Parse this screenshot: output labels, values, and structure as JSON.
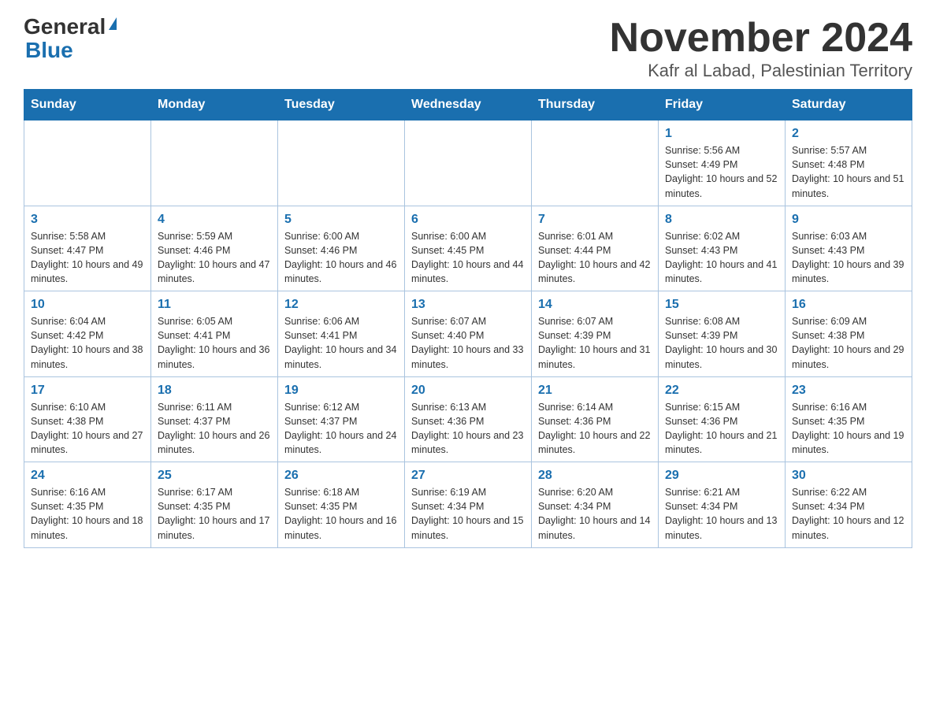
{
  "header": {
    "logo_general": "General",
    "logo_blue": "Blue",
    "title": "November 2024",
    "subtitle": "Kafr al Labad, Palestinian Territory"
  },
  "days_of_week": [
    "Sunday",
    "Monday",
    "Tuesday",
    "Wednesday",
    "Thursday",
    "Friday",
    "Saturday"
  ],
  "weeks": [
    [
      {
        "day": "",
        "info": ""
      },
      {
        "day": "",
        "info": ""
      },
      {
        "day": "",
        "info": ""
      },
      {
        "day": "",
        "info": ""
      },
      {
        "day": "",
        "info": ""
      },
      {
        "day": "1",
        "info": "Sunrise: 5:56 AM\nSunset: 4:49 PM\nDaylight: 10 hours and 52 minutes."
      },
      {
        "day": "2",
        "info": "Sunrise: 5:57 AM\nSunset: 4:48 PM\nDaylight: 10 hours and 51 minutes."
      }
    ],
    [
      {
        "day": "3",
        "info": "Sunrise: 5:58 AM\nSunset: 4:47 PM\nDaylight: 10 hours and 49 minutes."
      },
      {
        "day": "4",
        "info": "Sunrise: 5:59 AM\nSunset: 4:46 PM\nDaylight: 10 hours and 47 minutes."
      },
      {
        "day": "5",
        "info": "Sunrise: 6:00 AM\nSunset: 4:46 PM\nDaylight: 10 hours and 46 minutes."
      },
      {
        "day": "6",
        "info": "Sunrise: 6:00 AM\nSunset: 4:45 PM\nDaylight: 10 hours and 44 minutes."
      },
      {
        "day": "7",
        "info": "Sunrise: 6:01 AM\nSunset: 4:44 PM\nDaylight: 10 hours and 42 minutes."
      },
      {
        "day": "8",
        "info": "Sunrise: 6:02 AM\nSunset: 4:43 PM\nDaylight: 10 hours and 41 minutes."
      },
      {
        "day": "9",
        "info": "Sunrise: 6:03 AM\nSunset: 4:43 PM\nDaylight: 10 hours and 39 minutes."
      }
    ],
    [
      {
        "day": "10",
        "info": "Sunrise: 6:04 AM\nSunset: 4:42 PM\nDaylight: 10 hours and 38 minutes."
      },
      {
        "day": "11",
        "info": "Sunrise: 6:05 AM\nSunset: 4:41 PM\nDaylight: 10 hours and 36 minutes."
      },
      {
        "day": "12",
        "info": "Sunrise: 6:06 AM\nSunset: 4:41 PM\nDaylight: 10 hours and 34 minutes."
      },
      {
        "day": "13",
        "info": "Sunrise: 6:07 AM\nSunset: 4:40 PM\nDaylight: 10 hours and 33 minutes."
      },
      {
        "day": "14",
        "info": "Sunrise: 6:07 AM\nSunset: 4:39 PM\nDaylight: 10 hours and 31 minutes."
      },
      {
        "day": "15",
        "info": "Sunrise: 6:08 AM\nSunset: 4:39 PM\nDaylight: 10 hours and 30 minutes."
      },
      {
        "day": "16",
        "info": "Sunrise: 6:09 AM\nSunset: 4:38 PM\nDaylight: 10 hours and 29 minutes."
      }
    ],
    [
      {
        "day": "17",
        "info": "Sunrise: 6:10 AM\nSunset: 4:38 PM\nDaylight: 10 hours and 27 minutes."
      },
      {
        "day": "18",
        "info": "Sunrise: 6:11 AM\nSunset: 4:37 PM\nDaylight: 10 hours and 26 minutes."
      },
      {
        "day": "19",
        "info": "Sunrise: 6:12 AM\nSunset: 4:37 PM\nDaylight: 10 hours and 24 minutes."
      },
      {
        "day": "20",
        "info": "Sunrise: 6:13 AM\nSunset: 4:36 PM\nDaylight: 10 hours and 23 minutes."
      },
      {
        "day": "21",
        "info": "Sunrise: 6:14 AM\nSunset: 4:36 PM\nDaylight: 10 hours and 22 minutes."
      },
      {
        "day": "22",
        "info": "Sunrise: 6:15 AM\nSunset: 4:36 PM\nDaylight: 10 hours and 21 minutes."
      },
      {
        "day": "23",
        "info": "Sunrise: 6:16 AM\nSunset: 4:35 PM\nDaylight: 10 hours and 19 minutes."
      }
    ],
    [
      {
        "day": "24",
        "info": "Sunrise: 6:16 AM\nSunset: 4:35 PM\nDaylight: 10 hours and 18 minutes."
      },
      {
        "day": "25",
        "info": "Sunrise: 6:17 AM\nSunset: 4:35 PM\nDaylight: 10 hours and 17 minutes."
      },
      {
        "day": "26",
        "info": "Sunrise: 6:18 AM\nSunset: 4:35 PM\nDaylight: 10 hours and 16 minutes."
      },
      {
        "day": "27",
        "info": "Sunrise: 6:19 AM\nSunset: 4:34 PM\nDaylight: 10 hours and 15 minutes."
      },
      {
        "day": "28",
        "info": "Sunrise: 6:20 AM\nSunset: 4:34 PM\nDaylight: 10 hours and 14 minutes."
      },
      {
        "day": "29",
        "info": "Sunrise: 6:21 AM\nSunset: 4:34 PM\nDaylight: 10 hours and 13 minutes."
      },
      {
        "day": "30",
        "info": "Sunrise: 6:22 AM\nSunset: 4:34 PM\nDaylight: 10 hours and 12 minutes."
      }
    ]
  ]
}
